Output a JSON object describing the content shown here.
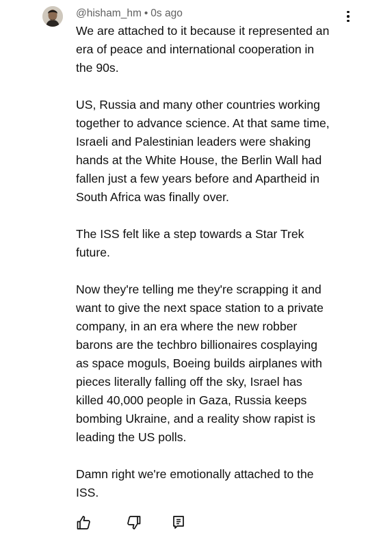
{
  "comment": {
    "author": "@hisham_hm",
    "separator": "•",
    "timestamp": "0s ago",
    "paragraphs": [
      [
        "We are attached to it because it represented an",
        "era of peace and international cooperation in",
        "the 90s."
      ],
      [
        "US, Russia and many other countries working",
        "together to advance science. At that same time,",
        "Israeli and Palestinian leaders were shaking",
        "hands at the White House, the Berlin Wall had",
        "fallen just a few years before and Apartheid in",
        "South Africa was finally over."
      ],
      [
        "The ISS felt like a step towards a Star Trek",
        "future."
      ],
      [
        "Now they're telling me they're scrapping it and",
        "want to give the next space station to a private",
        "company, in an era where the new robber",
        "barons are the techbro billionaires cosplaying",
        "as space moguls, Boeing builds airplanes with",
        "pieces literally falling off the sky, Israel has",
        "killed 40,000 people in Gaza, Russia keeps",
        "bombing Ukraine, and a reality show rapist is",
        "leading the US polls."
      ],
      [
        "Damn right we're emotionally attached to the",
        "ISS."
      ]
    ]
  },
  "icons": {
    "avatar": "user-avatar-photo",
    "menu": "vertical-dots-icon",
    "like": "thumb-up-icon",
    "dislike": "thumb-down-icon",
    "reply": "reply-comment-icon"
  },
  "colors": {
    "text": "#0f0f0f",
    "secondary_text": "#606060",
    "background": "#ffffff"
  }
}
